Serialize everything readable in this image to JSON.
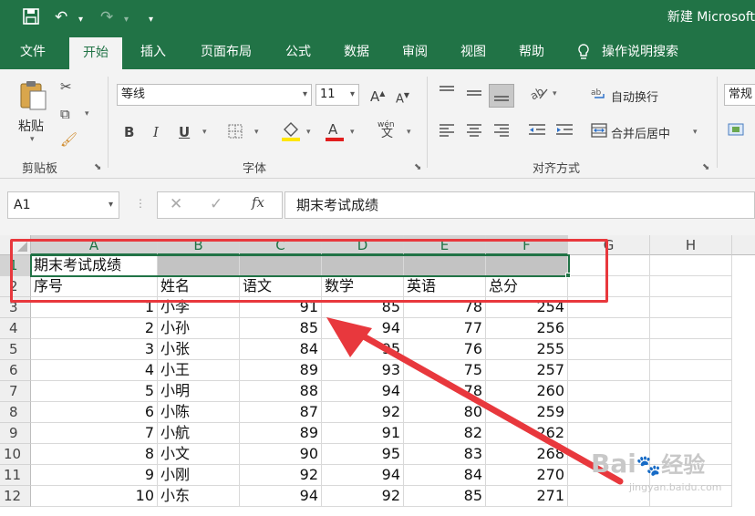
{
  "window": {
    "title": "新建 Microsoft"
  },
  "quick_access": {
    "icons": [
      "save-icon",
      "undo-icon",
      "redo-icon",
      "customize-icon"
    ]
  },
  "menu_tabs": [
    {
      "label": "文件"
    },
    {
      "label": "开始",
      "active": true
    },
    {
      "label": "插入"
    },
    {
      "label": "页面布局"
    },
    {
      "label": "公式"
    },
    {
      "label": "数据"
    },
    {
      "label": "审阅"
    },
    {
      "label": "视图"
    },
    {
      "label": "帮助"
    },
    {
      "label": "操作说明搜索"
    }
  ],
  "ribbon": {
    "clipboard": {
      "paste_label": "粘贴",
      "group_label": "剪贴板"
    },
    "font": {
      "font_name": "等线",
      "font_size": "11",
      "bold": "B",
      "italic": "I",
      "underline": "U",
      "phonetic": "wén",
      "phonetic_char": "文",
      "group_label": "字体"
    },
    "alignment": {
      "wrap_text": "自动换行",
      "merge_center": "合并后居中",
      "group_label": "对齐方式"
    },
    "number": {
      "format": "常规"
    }
  },
  "formula_bar": {
    "name_box": "A1",
    "cancel": "✕",
    "enter": "✓",
    "fx": "fx",
    "content": "期末考试成绩"
  },
  "sheet": {
    "columns": [
      "A",
      "B",
      "C",
      "D",
      "E",
      "F",
      "G",
      "H"
    ],
    "rows": [
      "1",
      "2",
      "3",
      "4",
      "5",
      "6",
      "7",
      "8",
      "9",
      "10",
      "11",
      "12"
    ],
    "title": "期末考试成绩",
    "headers": [
      "序号",
      "姓名",
      "语文",
      "数学",
      "英语",
      "总分"
    ],
    "data": [
      [
        "1",
        "小李",
        "91",
        "85",
        "78",
        "254"
      ],
      [
        "2",
        "小孙",
        "85",
        "94",
        "77",
        "256"
      ],
      [
        "3",
        "小张",
        "84",
        "95",
        "76",
        "255"
      ],
      [
        "4",
        "小王",
        "89",
        "93",
        "75",
        "257"
      ],
      [
        "5",
        "小明",
        "88",
        "94",
        "78",
        "260"
      ],
      [
        "6",
        "小陈",
        "87",
        "92",
        "80",
        "259"
      ],
      [
        "7",
        "小航",
        "89",
        "91",
        "82",
        "262"
      ],
      [
        "8",
        "小文",
        "90",
        "95",
        "83",
        "268"
      ],
      [
        "9",
        "小刚",
        "92",
        "94",
        "84",
        "270"
      ],
      [
        "10",
        "小东",
        "94",
        "92",
        "85",
        "271"
      ]
    ]
  },
  "watermark": {
    "brand": "Bai",
    "brand2": "经验",
    "url": "jingyan.baidu.com"
  },
  "colors": {
    "excel_green": "#217346",
    "annotation_red": "#e8383d"
  }
}
